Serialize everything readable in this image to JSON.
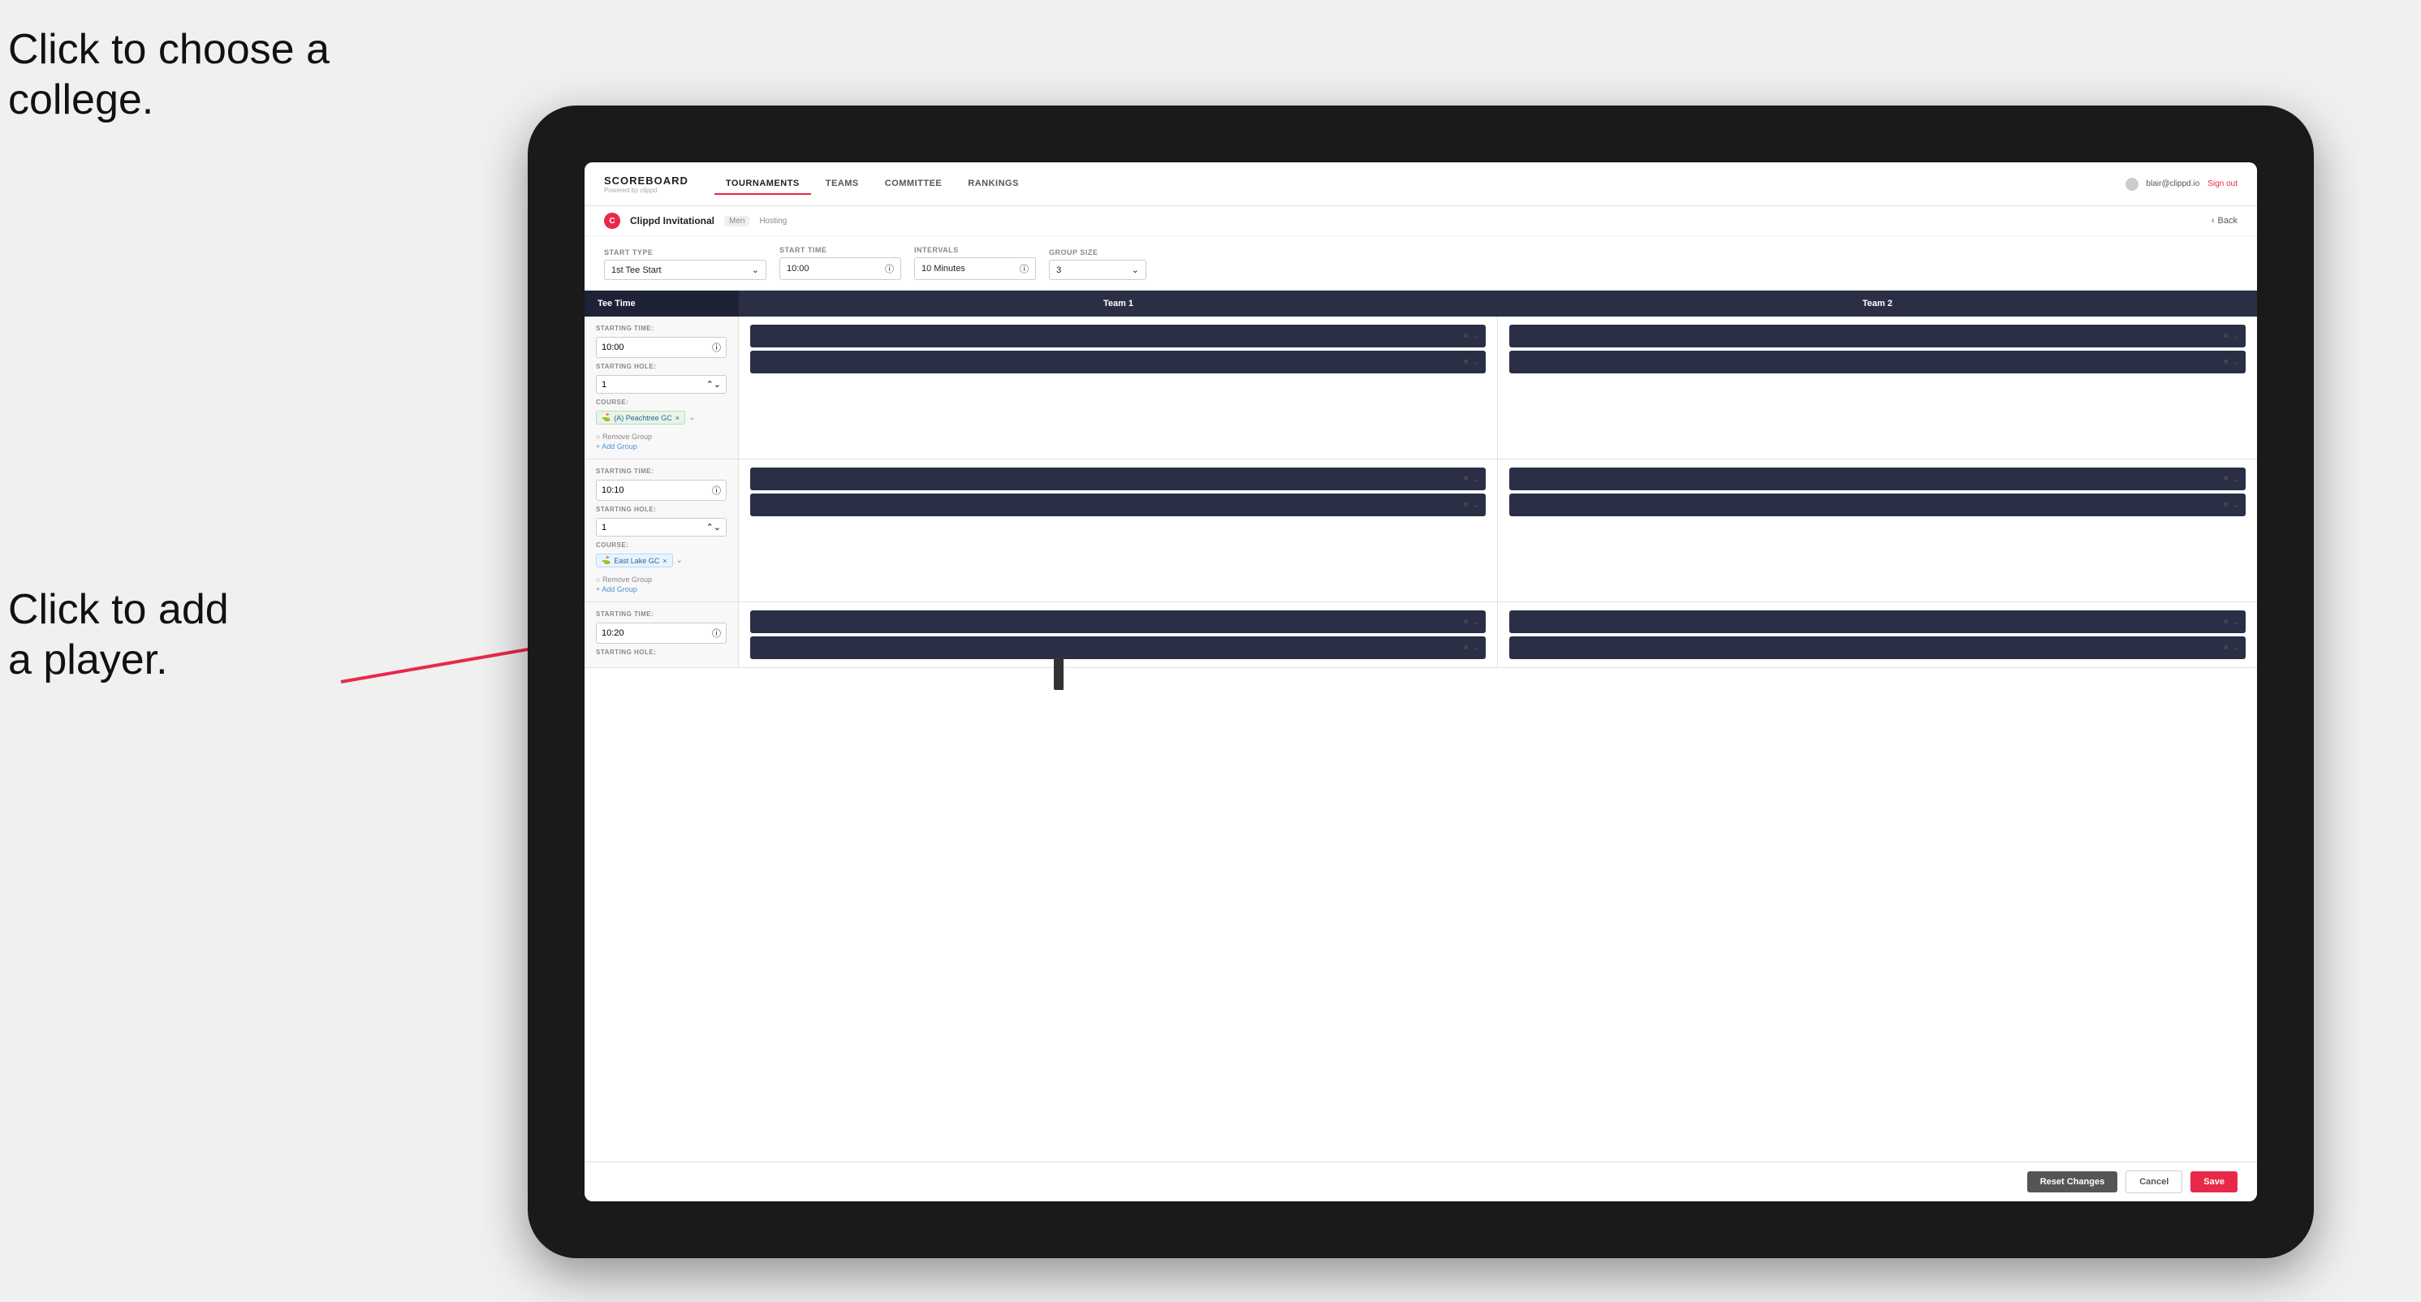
{
  "annotations": {
    "annotation1_line1": "Click to choose a",
    "annotation1_line2": "college.",
    "annotation2_line1": "Click to add",
    "annotation2_line2": "a player."
  },
  "nav": {
    "brand": "SCOREBOARD",
    "brand_sub": "Powered by clippd",
    "links": [
      "TOURNAMENTS",
      "TEAMS",
      "COMMITTEE",
      "RANKINGS"
    ],
    "active_link": "TOURNAMENTS",
    "user_email": "blair@clippd.io",
    "sign_out": "Sign out"
  },
  "sub_header": {
    "logo": "C",
    "title": "Clippd Invitational",
    "badge": "Men",
    "tag": "Hosting",
    "back": "Back"
  },
  "form": {
    "start_type_label": "Start Type",
    "start_type_value": "1st Tee Start",
    "start_time_label": "Start Time",
    "start_time_value": "10:00",
    "intervals_label": "Intervals",
    "intervals_value": "10 Minutes",
    "group_size_label": "Group Size",
    "group_size_value": "3"
  },
  "table": {
    "col1": "Tee Time",
    "col2": "Team 1",
    "col3": "Team 2"
  },
  "rows": [
    {
      "start_time": "10:00",
      "starting_hole": "1",
      "course": "(A) Peachtree GC",
      "course_type": "green",
      "team1_slots": 2,
      "team2_slots": 2
    },
    {
      "start_time": "10:10",
      "starting_hole": "1",
      "course": "East Lake GC",
      "course_type": "blue",
      "team1_slots": 2,
      "team2_slots": 2
    },
    {
      "start_time": "10:20",
      "starting_hole": "",
      "course": "",
      "course_type": "",
      "team1_slots": 2,
      "team2_slots": 2
    }
  ],
  "labels": {
    "starting_time": "STARTING TIME:",
    "starting_hole": "STARTING HOLE:",
    "course": "COURSE:",
    "remove_group": "Remove Group",
    "add_group": "+ Add Group"
  },
  "footer": {
    "reset": "Reset Changes",
    "cancel": "Cancel",
    "save": "Save"
  }
}
